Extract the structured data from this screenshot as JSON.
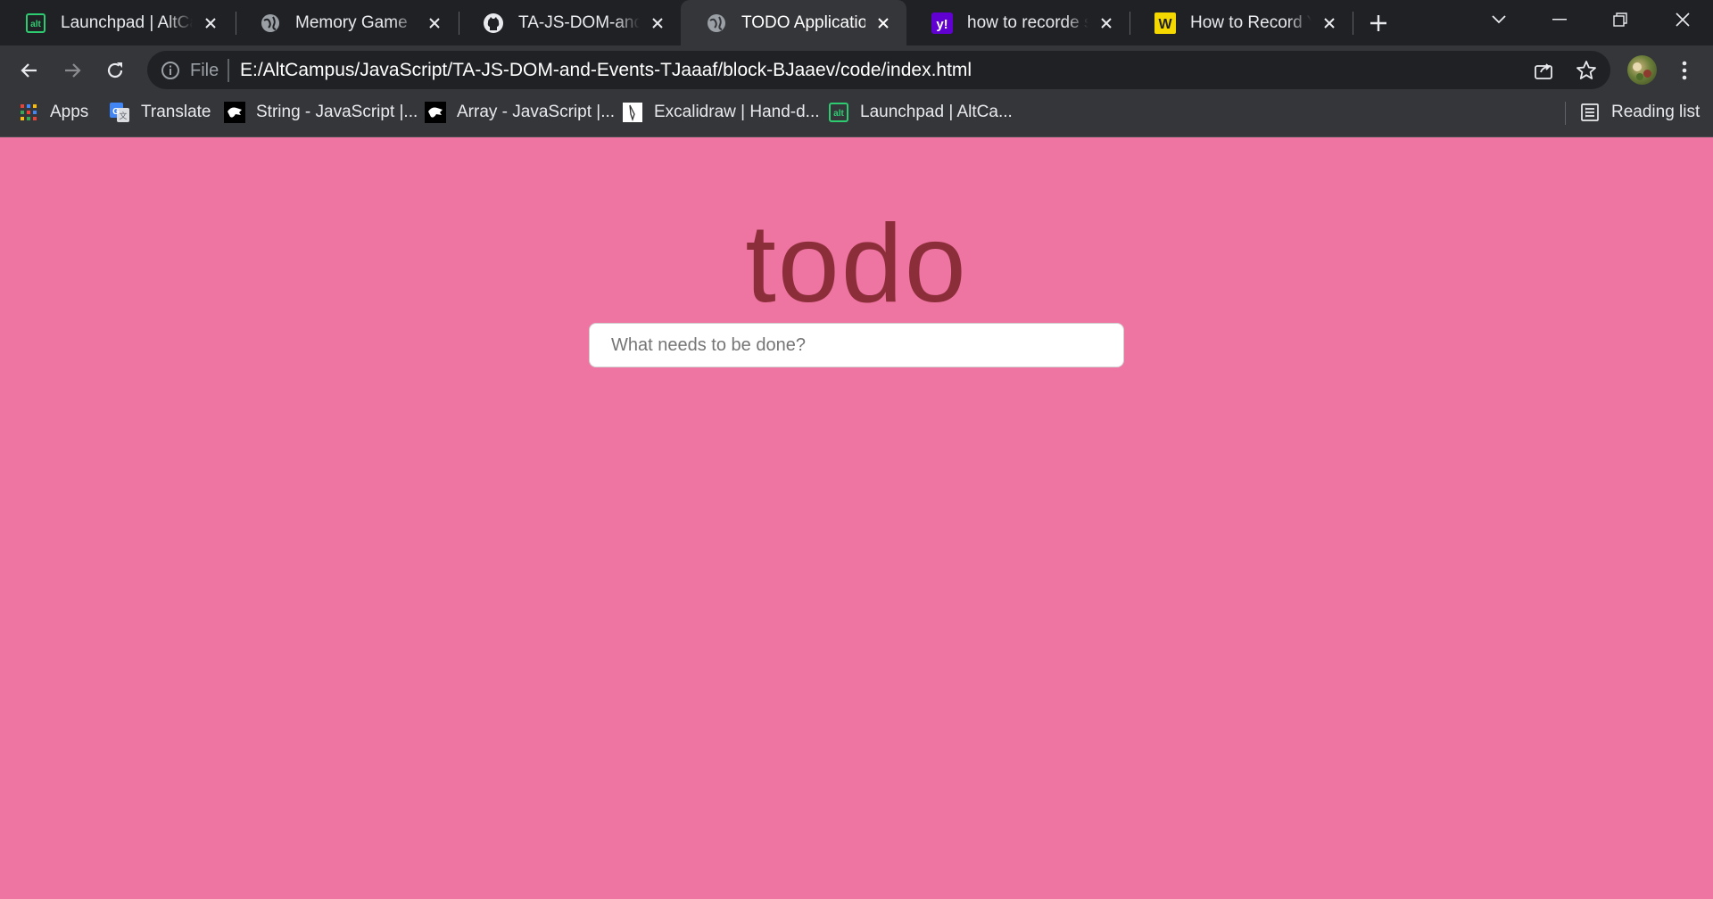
{
  "browser": {
    "tabs": [
      {
        "title": "Launchpad | AltCampus",
        "favicon": "altcampus-icon",
        "active": false
      },
      {
        "title": "Memory Game",
        "favicon": "globe-icon",
        "active": false
      },
      {
        "title": "TA-JS-DOM-and-Events",
        "favicon": "github-icon",
        "active": false
      },
      {
        "title": "TODO Application",
        "favicon": "globe-icon",
        "active": true
      },
      {
        "title": "how to recorde screen",
        "favicon": "yahoo-icon",
        "active": false
      },
      {
        "title": "How to Record Your",
        "favicon": "wikihow-icon",
        "active": false
      }
    ],
    "address_bar": {
      "scheme_label": "File",
      "url": "E:/AltCampus/JavaScript/TA-JS-DOM-and-Events-TJaaaf/block-BJaaev/code/index.html"
    },
    "bookmarks": [
      {
        "label": "Apps",
        "icon": "apps-grid-icon"
      },
      {
        "label": "Translate",
        "icon": "google-translate-icon"
      },
      {
        "label": "String - JavaScript |...",
        "icon": "mdn-icon"
      },
      {
        "label": "Array - JavaScript |...",
        "icon": "mdn-icon"
      },
      {
        "label": "Excalidraw | Hand-d...",
        "icon": "excalidraw-icon"
      },
      {
        "label": "Launchpad | AltCa...",
        "icon": "altcampus-icon"
      }
    ],
    "reading_list_label": "Reading list",
    "colors": {
      "tabstrip": "#202124",
      "toolbar": "#35363a"
    }
  },
  "page": {
    "heading": "todo",
    "input_placeholder": "What needs to be done?",
    "colors": {
      "background": "#ee74a1",
      "heading": "#8b2e3a"
    }
  }
}
